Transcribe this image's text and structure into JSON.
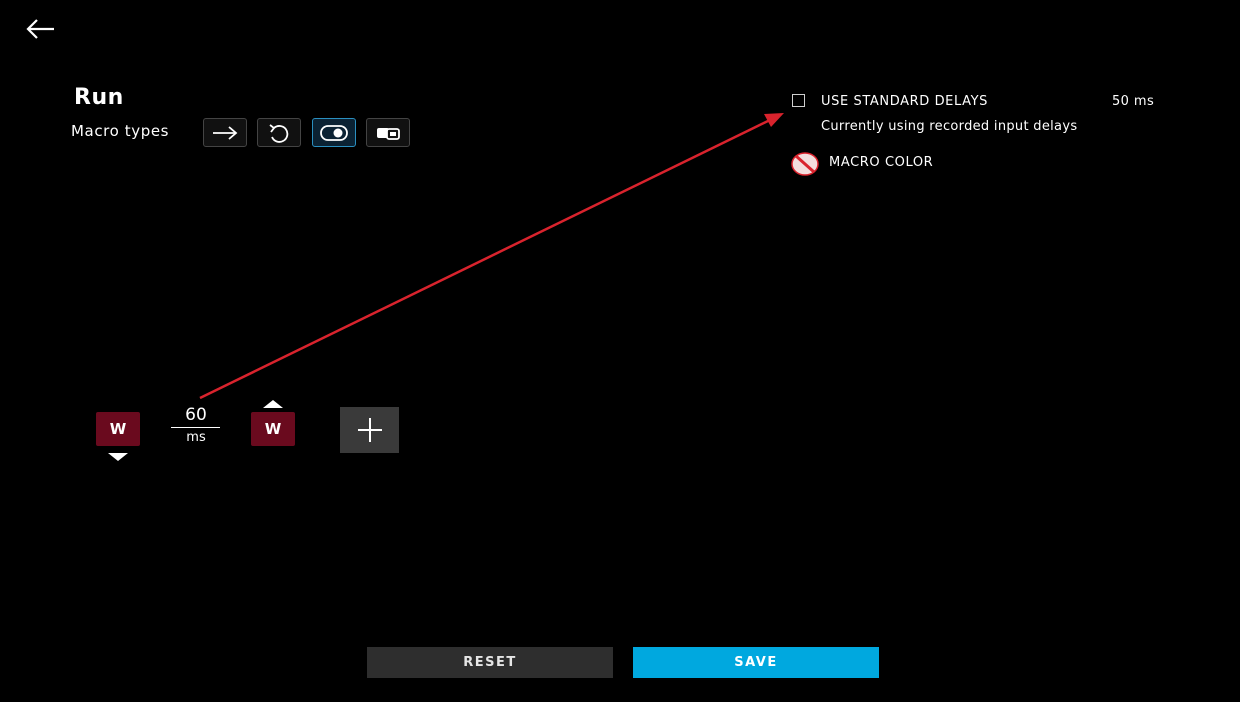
{
  "header": {
    "back_icon": "back-arrow-icon",
    "title": "Run"
  },
  "macro_types": {
    "label": "Macro types",
    "items": [
      {
        "icon": "arrow-right-icon",
        "active": false
      },
      {
        "icon": "repeat-loop-icon",
        "active": false
      },
      {
        "icon": "toggle-icon",
        "active": true
      },
      {
        "icon": "sequence-icon",
        "active": false
      }
    ]
  },
  "options": {
    "standard_delays_label": "USE STANDARD DELAYS",
    "standard_delays_checked": false,
    "standard_delays_value": "50 ms",
    "delay_status": "Currently using recorded input delays",
    "macro_color_label": "MACRO COLOR",
    "macro_color_icon": "no-color-icon"
  },
  "sequence": {
    "key_down": {
      "label": "W",
      "direction": "down"
    },
    "delay": {
      "value": "60",
      "unit": "ms"
    },
    "key_up": {
      "label": "W",
      "direction": "up"
    },
    "add_icon": "plus-icon"
  },
  "footer": {
    "reset_label": "RESET",
    "save_label": "SAVE"
  },
  "colors": {
    "background": "#000000",
    "key_fill": "#6a0a1e",
    "save_accent": "#00a8df",
    "reset_fill": "#2e2e2e",
    "annotation_arrow": "#d9232d"
  }
}
